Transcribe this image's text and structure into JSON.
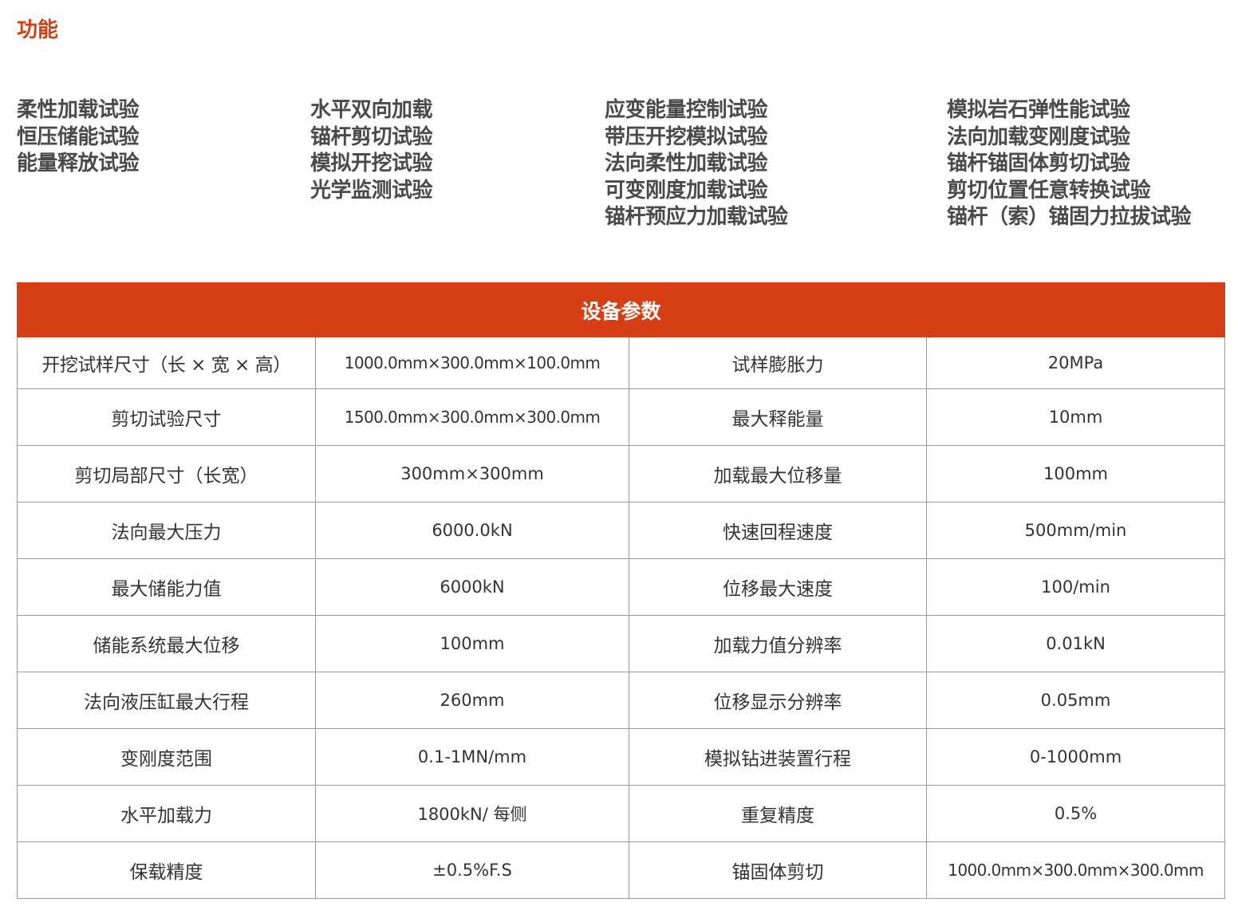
{
  "section_title": "功能",
  "features": {
    "columns": [
      [
        "柔性加载试验",
        "恒压储能试验",
        "能量释放试验"
      ],
      [
        "水平双向加载",
        "锚杆剪切试验",
        "模拟开挖试验",
        "光学监测试验"
      ],
      [
        "应变能量控制试验",
        "带压开挖模拟试验",
        "法向柔性加载试验",
        "可变刚度加载试验",
        "锚杆预应力加载试验"
      ],
      [
        "模拟岩石弹性能试验",
        "法向加载变刚度试验",
        "锚杆锚固体剪切试验",
        "剪切位置任意转换试验",
        "锚杆（索）锚固力拉拔试验"
      ]
    ]
  },
  "params_table": {
    "title": "设备参数",
    "rows": [
      [
        "开挖试样尺寸（长 × 宽 × 高）",
        "1000.0mm×300.0mm×100.0mm",
        "试样膨胀力",
        "20MPa"
      ],
      [
        "剪切试验尺寸",
        "1500.0mm×300.0mm×300.0mm",
        "最大释能量",
        "10mm"
      ],
      [
        "剪切局部尺寸（长宽）",
        "300mm×300mm",
        "加载最大位移量",
        "100mm"
      ],
      [
        "法向最大压力",
        "6000.0kN",
        "快速回程速度",
        "500mm/min"
      ],
      [
        "最大储能力值",
        "6000kN",
        "位移最大速度",
        "100/min"
      ],
      [
        "储能系统最大位移",
        "100mm",
        "加载力值分辨率",
        "0.01kN"
      ],
      [
        "法向液压缸最大行程",
        "260mm",
        "位移显示分辨率",
        "0.05mm"
      ],
      [
        "变刚度范围",
        "0.1-1MN/mm",
        "模拟钻进装置行程",
        "0-1000mm"
      ],
      [
        "水平加载力",
        "1800kN/ 每侧",
        "重复精度",
        "0.5%"
      ],
      [
        "保载精度",
        "±0.5%F.S",
        "锚固体剪切",
        "1000.0mm×300.0mm×300.0mm"
      ]
    ]
  }
}
